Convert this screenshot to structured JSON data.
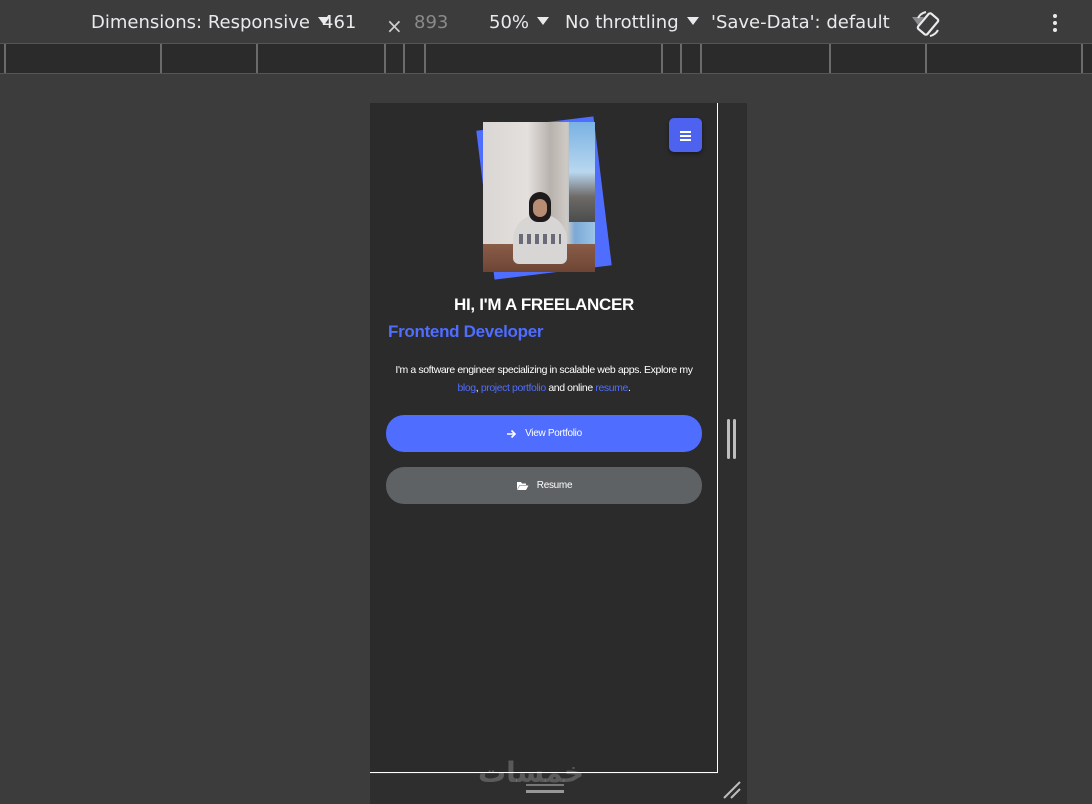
{
  "devtools": {
    "dimensions_label": "Dimensions: Responsive",
    "width_value": "461",
    "times_sign": "×",
    "height_placeholder": "893",
    "zoom": "50%",
    "throttling": "No throttling",
    "save_data": "'Save-Data': default"
  },
  "page": {
    "menu_icon": "hamburger-icon",
    "title": "HI, I'M A FREELANCER",
    "role": "Frontend Developer",
    "description_intro": "I'm a software engineer specializing in scalable web apps. Explore my",
    "link_blog": "blog",
    "sep1": ",",
    "link_portfolio": "project portfolio",
    "and_online": "and online",
    "link_resume": "resume",
    "period": ".",
    "buttons": {
      "primary_label": "View Portfolio",
      "primary_icon": "arrow-right-icon",
      "secondary_label": "Resume",
      "secondary_icon": "folder-open-icon"
    }
  },
  "watermark": "خمسات",
  "colors": {
    "accent": "#4f6dff",
    "background": "#2b2b2b",
    "secondary_button": "#5f6264"
  }
}
